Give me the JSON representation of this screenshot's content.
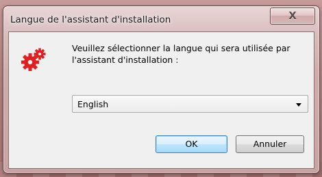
{
  "window": {
    "title": "Langue de l'assistant d'installation"
  },
  "close_button": {
    "icon": "close-icon",
    "glyph": "X"
  },
  "app_icon": {
    "icon": "gears-icon",
    "color": "#e02020"
  },
  "message": {
    "text": "Veuillez sélectionner la langue qui sera utilisée par l'assistant d'installation :"
  },
  "language_select": {
    "selected": "English"
  },
  "buttons": {
    "ok": "OK",
    "cancel": "Annuler"
  }
}
